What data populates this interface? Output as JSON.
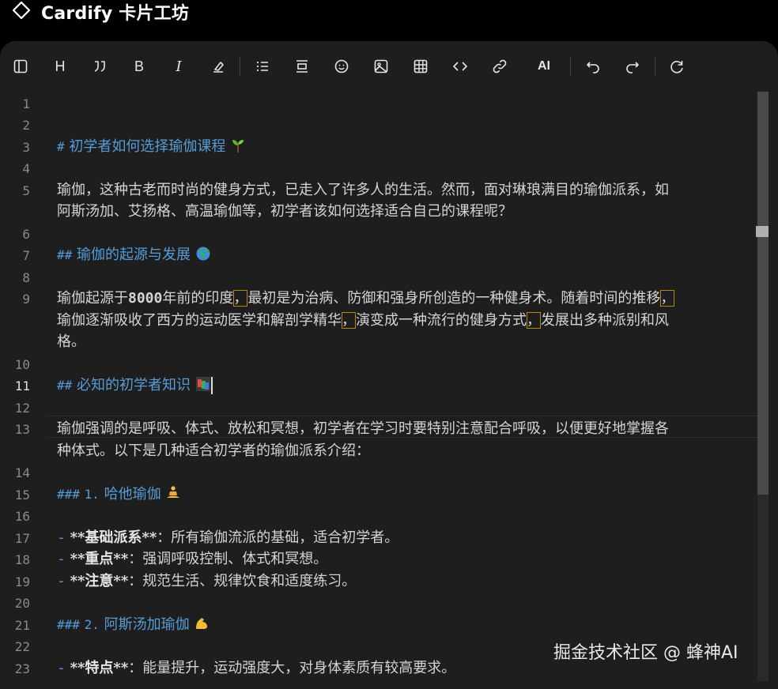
{
  "app": {
    "title": "Cardify 卡片工坊",
    "logo_icon": "diamond-outline-icon"
  },
  "toolbar": {
    "buttons": [
      {
        "name": "toggle-sidebar-button",
        "icon": "sidebar-icon"
      },
      {
        "name": "heading-button",
        "label": "H"
      },
      {
        "name": "quote-button",
        "icon": "quote-icon"
      },
      {
        "name": "bold-button",
        "label": "B"
      },
      {
        "name": "italic-button",
        "label": "I"
      },
      {
        "name": "strikethrough-button",
        "icon": "eraser-icon"
      },
      {
        "name": "bullet-list-button",
        "icon": "list-icon"
      },
      {
        "name": "align-button",
        "icon": "align-center-icon"
      },
      {
        "name": "emoji-button",
        "icon": "smile-icon"
      },
      {
        "name": "image-button",
        "icon": "image-icon"
      },
      {
        "name": "table-button",
        "icon": "table-icon"
      },
      {
        "name": "code-button",
        "icon": "code-icon"
      },
      {
        "name": "link-button",
        "icon": "link-icon"
      },
      {
        "name": "ai-button",
        "label": "AI"
      },
      {
        "name": "undo-button",
        "icon": "undo-icon"
      },
      {
        "name": "redo-button",
        "icon": "redo-icon"
      },
      {
        "name": "refresh-button",
        "icon": "refresh-icon"
      }
    ]
  },
  "editor": {
    "active_line": 11,
    "lines": {
      "n3": {
        "mark": "#",
        "text": "初学者如何选择瑜伽课程",
        "emoji": "seedling"
      },
      "n5a": "瑜伽，这种古老而时尚的健身方式，已走入了许多人的生活。然而，面对琳琅满目的瑜伽派系，如",
      "n5b": "阿斯汤加、艾扬格、高温瑜伽等，初学者该如何选择适合自己的课程呢？",
      "n7": {
        "mark": "##",
        "text": "瑜伽的起源与发展",
        "emoji": "globe"
      },
      "n9a_1": "瑜伽起源于",
      "n9a_num": "8000",
      "n9a_2": "年前的印度",
      "n9a_3": "，",
      "n9a_4": "最初是为治病、防御和强身所创造的一种健身术。随着时间的推移",
      "n9a_5": "，",
      "n9b_1": "瑜伽逐渐吸收了西方的运动医学和解剖学精华",
      "n9b_2": "，",
      "n9b_3": "演变成一种流行的健身方式",
      "n9b_4": "，",
      "n9b_5": "发展出多种派别和风",
      "n9c": "格。",
      "n11": {
        "mark": "##",
        "text": "必知的初学者知识",
        "emoji": "books"
      },
      "n13a": "瑜伽强调的是呼吸、体式、放松和冥想，初学者在学习时要特别注意配合呼吸，以便更好地掌握各",
      "n13b": "种体式。以下是几种适合初学者的瑜伽派系介绍：",
      "n15": {
        "mark": "###",
        "num": "1.",
        "text": "哈他瑜伽",
        "emoji": "lotus-position"
      },
      "n17": {
        "dash": "-",
        "bold": "**基础派系**",
        "text": "：所有瑜伽流派的基础，适合初学者。"
      },
      "n18": {
        "dash": "-",
        "bold": "**重点**",
        "text": "：强调呼吸控制、体式和冥想。"
      },
      "n19": {
        "dash": "-",
        "bold": "**注意**",
        "text": "：规范生活、规律饮食和适度练习。"
      },
      "n21": {
        "mark": "###",
        "num": "2.",
        "text": "阿斯汤加瑜伽",
        "emoji": "flexed-biceps"
      },
      "n23": {
        "dash": "-",
        "bold": "**特点**",
        "text": "：能量提升，运动强度大，对身体素质有较高要求。"
      }
    },
    "line_numbers": [
      "1",
      "2",
      "3",
      "4",
      "5",
      "6",
      "7",
      "8",
      "9",
      "10",
      "11",
      "12",
      "13",
      "14",
      "15",
      "16",
      "17",
      "18",
      "19",
      "20",
      "21",
      "22",
      "23"
    ]
  },
  "watermark": "掘金技术社区 @ 蜂神AI"
}
